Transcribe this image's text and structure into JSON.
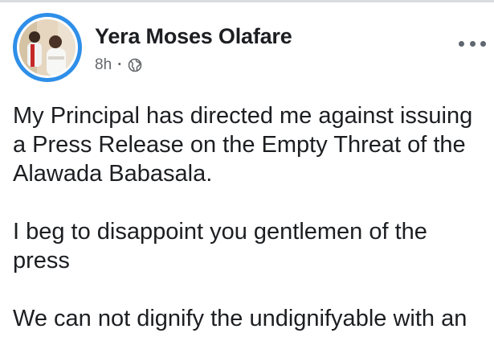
{
  "post": {
    "author": "Yera Moses Olafare",
    "time": "8h",
    "separator": "·",
    "audience_icon": "globe-icon",
    "menu_icon": "more-options-icon",
    "paragraphs": [
      "My Principal has directed me against issuing a Press Release on the Empty Threat of the Alawada Babasala.",
      "I beg to disappoint you gentlemen of the press",
      "We can not dignify the undignifyable with an"
    ]
  },
  "colors": {
    "avatar_ring": "#2f8fe8",
    "text": "#1c1e21",
    "meta": "#65676b",
    "top_rule": "#d9dbdf"
  }
}
